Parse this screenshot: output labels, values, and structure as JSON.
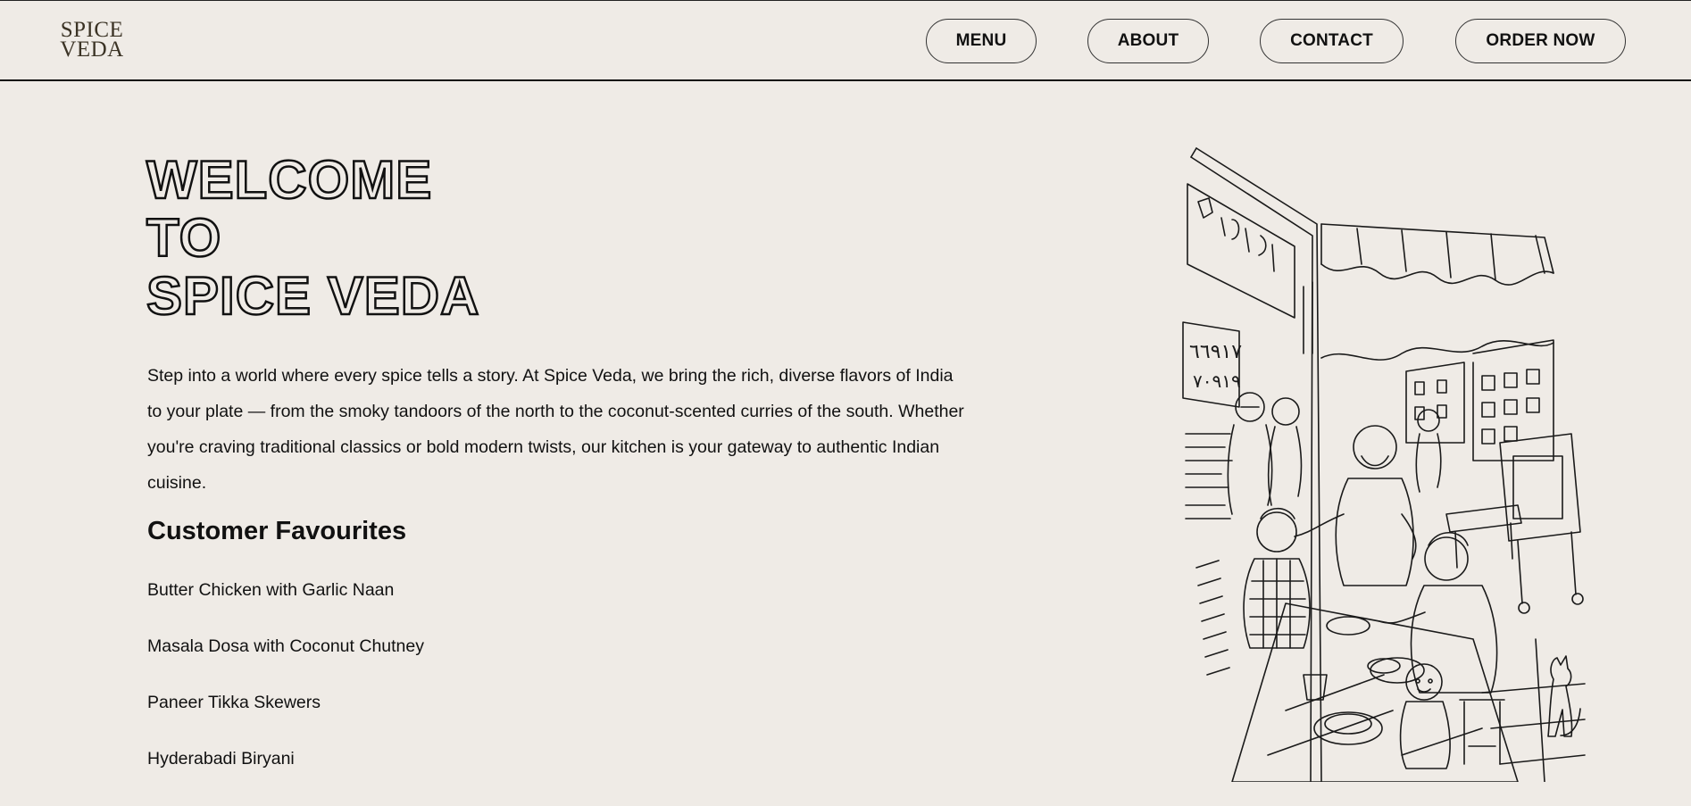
{
  "header": {
    "logo_line1": "SPICE",
    "logo_line2": "VEDA",
    "nav": {
      "menu": "MENU",
      "about": "ABOUT",
      "contact": "CONTACT",
      "order": "ORDER NOW"
    }
  },
  "hero": {
    "title_line1": "WELCOME",
    "title_line2": "TO",
    "title_line3": "SPICE VEDA",
    "intro": "Step into a world where every spice tells a story. At Spice Veda, we bring the rich, diverse flavors of India to your plate — from the smoky tandoors of the north to the coconut-scented curries of the south. Whether you're craving traditional classics or bold modern twists, our kitchen is your gateway to authentic Indian cuisine."
  },
  "favourites": {
    "heading": "Customer Favourites",
    "items": [
      "Butter Chicken with Garlic Naan",
      "Masala Dosa with Coconut Chutney",
      "Paneer Tikka Skewers",
      "Hyderabadi Biryani"
    ]
  },
  "illustration": {
    "sign_line1": "٦٦٩١٧",
    "sign_line2": "٧٠٩١٩"
  }
}
